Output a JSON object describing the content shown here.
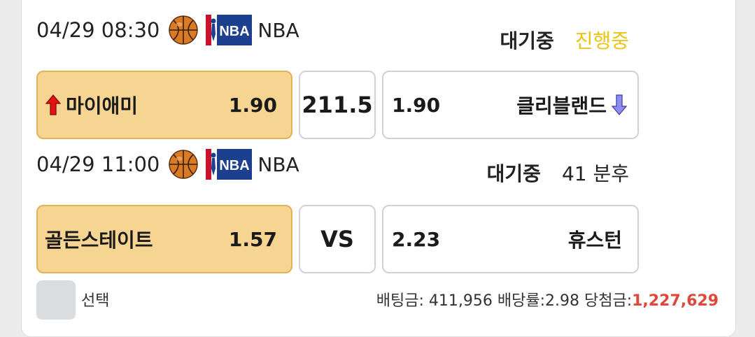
{
  "games": [
    {
      "time": "04/29 08:30",
      "league": "NBA",
      "status": "대기중",
      "status_extra": "진행중",
      "home": {
        "team": "마이애미",
        "odds": "1.90",
        "indicator": "up-arrow"
      },
      "center": "211.5",
      "away": {
        "team": "클리블랜드",
        "odds": "1.90",
        "indicator": "down-arrow"
      }
    },
    {
      "time": "04/29 11:00",
      "league": "NBA",
      "status": "대기중",
      "status_extra": "41 분후",
      "home": {
        "team": "골든스테이트",
        "odds": "1.57"
      },
      "center": "VS",
      "away": {
        "team": "휴스턴",
        "odds": "2.23"
      }
    }
  ],
  "footer": {
    "select_label": "선택",
    "bet_amount_label": "배팅금:",
    "bet_amount": "411,956",
    "odds_label": "배당률:",
    "odds": "2.98",
    "win_label": "당첨금:",
    "win_amount": "1,227,629"
  },
  "colors": {
    "selected_bg": "#f6d491",
    "live_status": "#ecc417",
    "win_amount": "#e0463b"
  }
}
